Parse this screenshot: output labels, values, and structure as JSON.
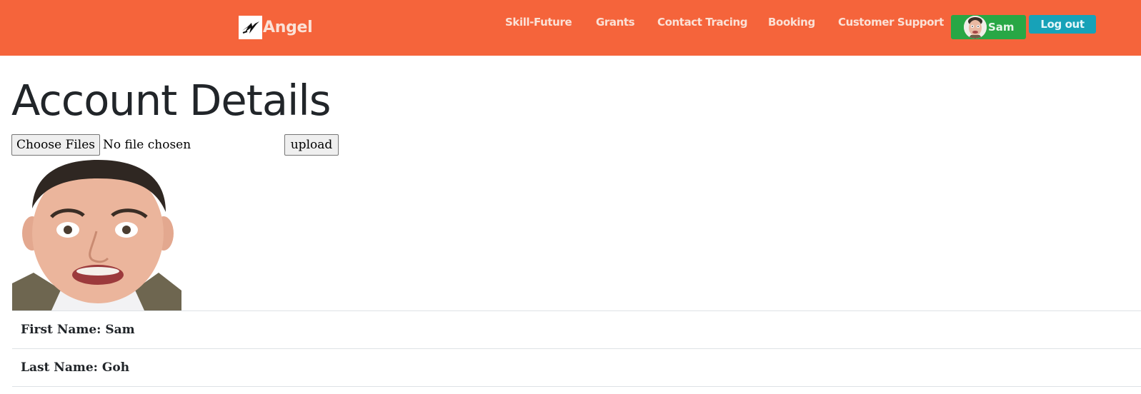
{
  "navbar": {
    "brand_name": "Angel",
    "brand_icon": "angel-logo-icon",
    "links": [
      {
        "label": "Skill-Future"
      },
      {
        "label": "Grants"
      },
      {
        "label": "Contact Tracing"
      },
      {
        "label": "Booking"
      },
      {
        "label": "Customer Support"
      }
    ],
    "user": {
      "name": "Sam",
      "avatar_icon": "user-avatar-icon"
    },
    "logout_label": "Log out"
  },
  "main": {
    "title": "Account Details",
    "file_input": {
      "button_label": "Choose Files",
      "status": "No file chosen"
    },
    "upload_label": "upload",
    "fields": [
      {
        "text": "First Name: Sam"
      },
      {
        "text": "Last Name: Goh"
      }
    ]
  },
  "colors": {
    "navbar_bg": "#f5643b",
    "user_button_bg": "#28a745",
    "logout_button_bg": "#17a2b8"
  }
}
